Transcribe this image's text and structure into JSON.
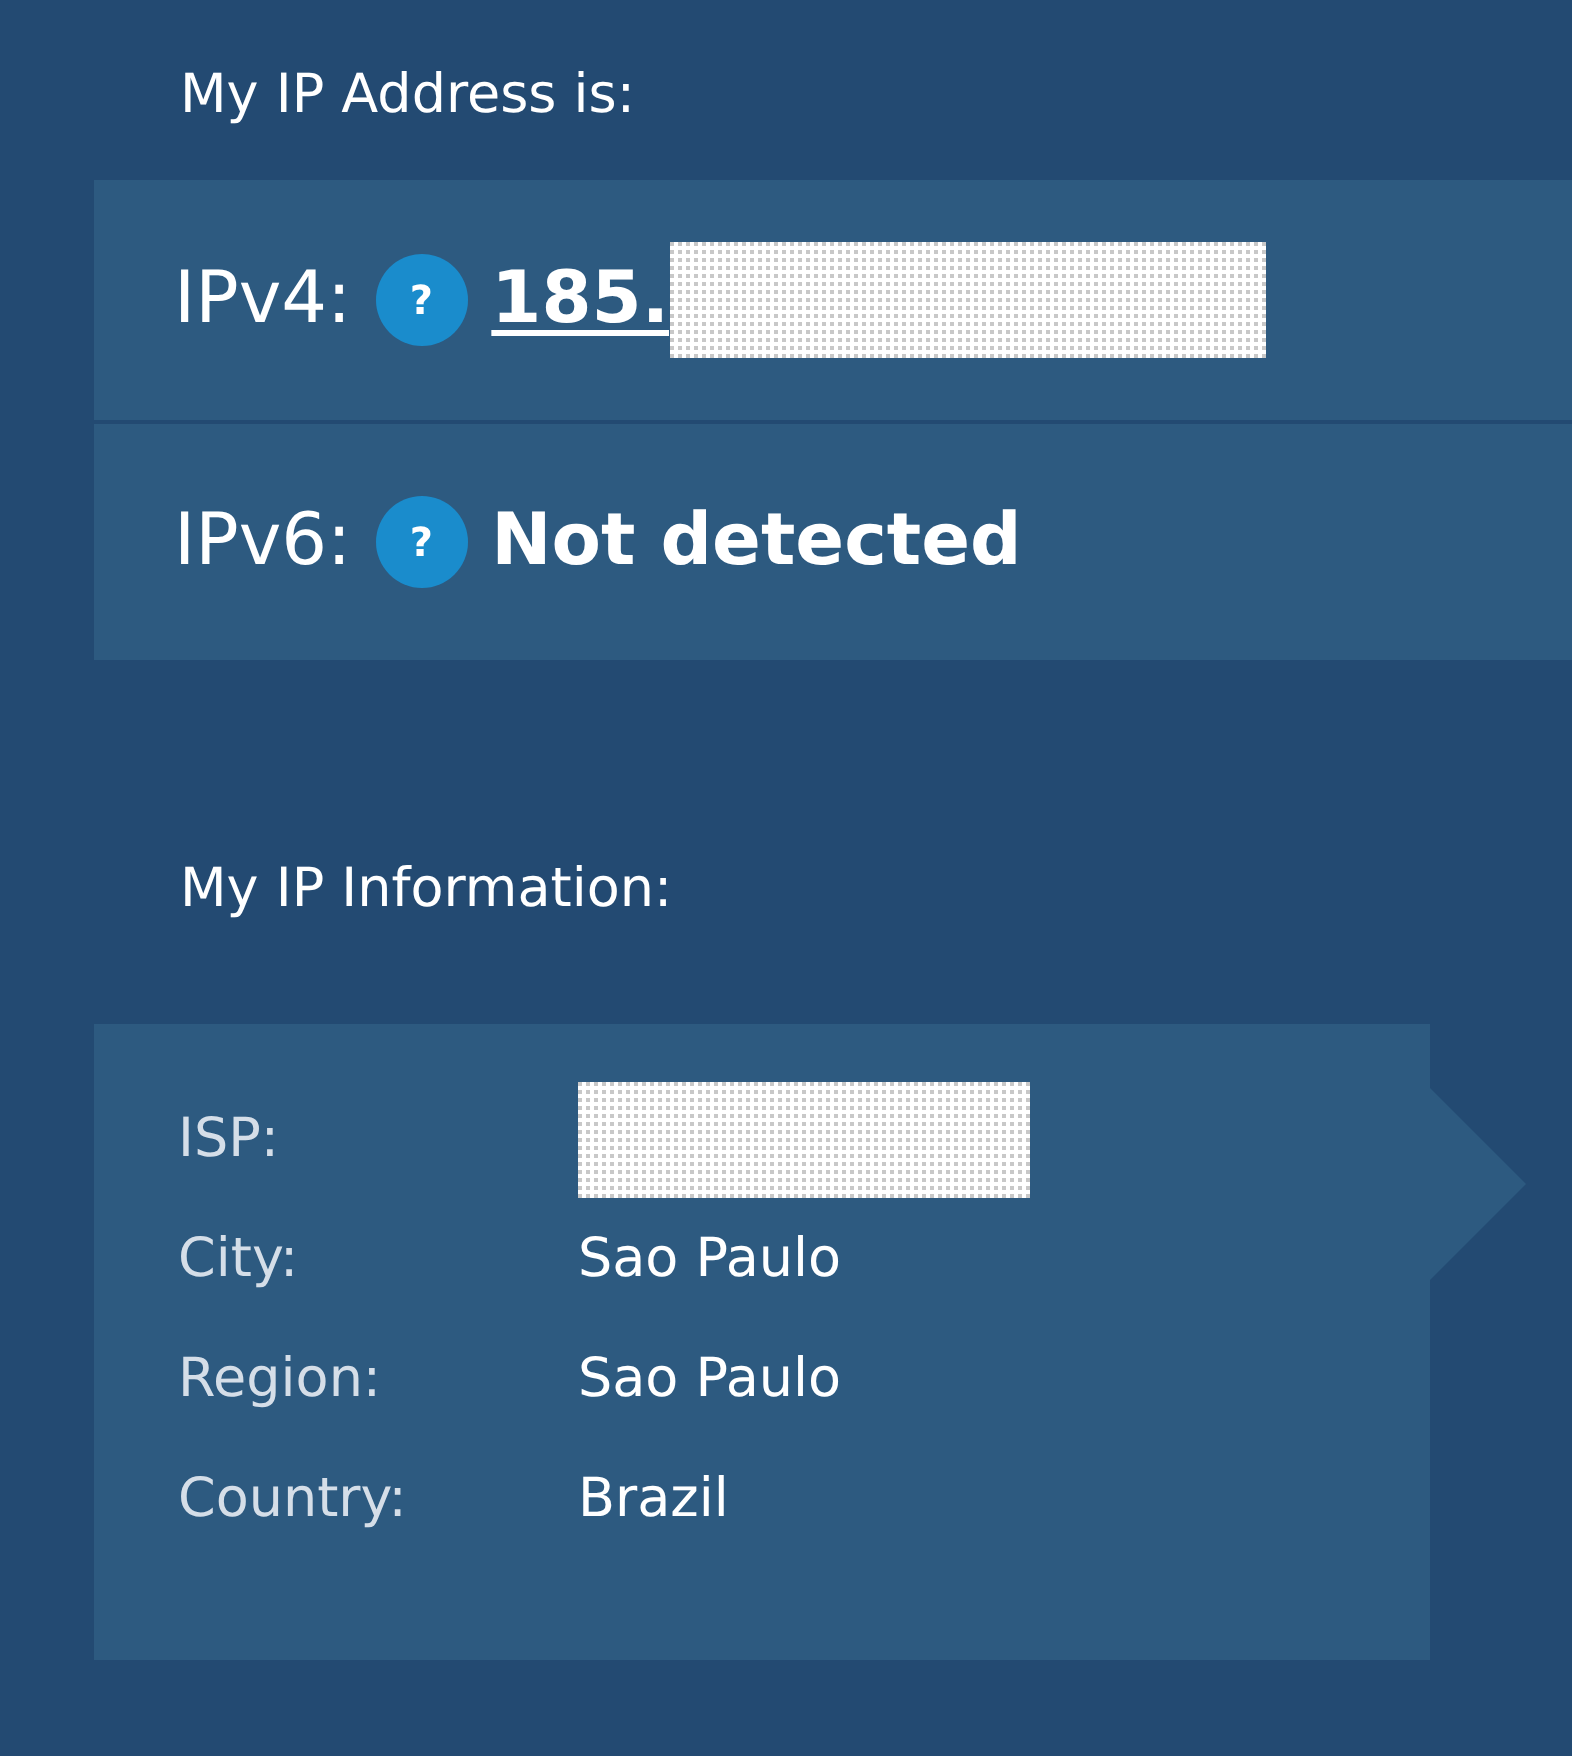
{
  "address_heading": "My IP Address is:",
  "addresses": [
    {
      "label": "IPv4:",
      "help": "?",
      "value": "185.",
      "link": true,
      "masked": true
    },
    {
      "label": "IPv6:",
      "help": "?",
      "value": "Not detected",
      "link": false
    }
  ],
  "info_heading": "My IP Information:",
  "info": [
    {
      "label": "ISP:",
      "masked": true
    },
    {
      "label": "City:",
      "value": "Sao Paulo"
    },
    {
      "label": "Region:",
      "value": "Sao Paulo"
    },
    {
      "label": "Country:",
      "value": "Brazil"
    }
  ]
}
